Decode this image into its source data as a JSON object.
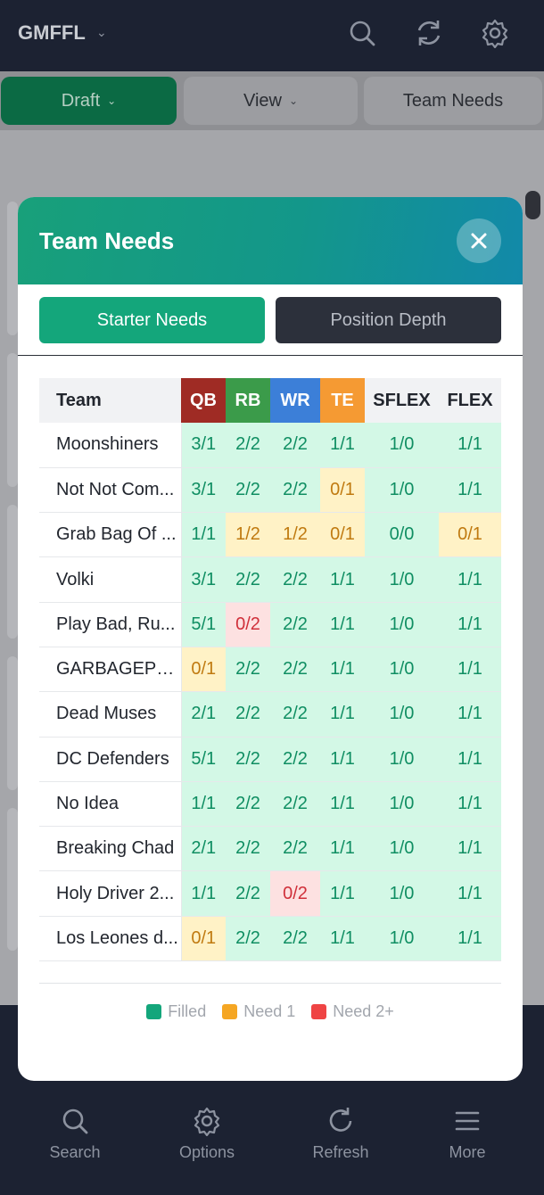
{
  "app": {
    "title": "GMFFL"
  },
  "toolbar": {
    "draft_label": "Draft",
    "view_label": "View",
    "team_needs_label": "Team Needs"
  },
  "modal": {
    "title": "Team Needs",
    "segments": {
      "starter": "Starter Needs",
      "depth": "Position Depth"
    },
    "columns": [
      "Team",
      "QB",
      "RB",
      "WR",
      "TE",
      "SFLEX",
      "FLEX"
    ],
    "rows": [
      {
        "team": "Moonshiners",
        "values": [
          "3/1",
          "2/2",
          "2/2",
          "1/1",
          "1/0",
          "1/1"
        ],
        "status": [
          "filled",
          "filled",
          "filled",
          "filled",
          "filled",
          "filled"
        ]
      },
      {
        "team": "Not Not Com...",
        "values": [
          "3/1",
          "2/2",
          "2/2",
          "0/1",
          "1/0",
          "1/1"
        ],
        "status": [
          "filled",
          "filled",
          "filled",
          "need1",
          "filled",
          "filled"
        ]
      },
      {
        "team": "Grab Bag Of ...",
        "values": [
          "1/1",
          "1/2",
          "1/2",
          "0/1",
          "0/0",
          "0/1"
        ],
        "status": [
          "filled",
          "need1",
          "need1",
          "need1",
          "filled",
          "need1"
        ]
      },
      {
        "team": "Volki",
        "values": [
          "3/1",
          "2/2",
          "2/2",
          "1/1",
          "1/0",
          "1/1"
        ],
        "status": [
          "filled",
          "filled",
          "filled",
          "filled",
          "filled",
          "filled"
        ]
      },
      {
        "team": "Play Bad, Ru...",
        "values": [
          "5/1",
          "0/2",
          "2/2",
          "1/1",
          "1/0",
          "1/1"
        ],
        "status": [
          "filled",
          "need2",
          "filled",
          "filled",
          "filled",
          "filled"
        ]
      },
      {
        "team": "GARBAGEPL...",
        "values": [
          "0/1",
          "2/2",
          "2/2",
          "1/1",
          "1/0",
          "1/1"
        ],
        "status": [
          "need1",
          "filled",
          "filled",
          "filled",
          "filled",
          "filled"
        ]
      },
      {
        "team": "Dead Muses",
        "values": [
          "2/1",
          "2/2",
          "2/2",
          "1/1",
          "1/0",
          "1/1"
        ],
        "status": [
          "filled",
          "filled",
          "filled",
          "filled",
          "filled",
          "filled"
        ]
      },
      {
        "team": "DC Defenders",
        "values": [
          "5/1",
          "2/2",
          "2/2",
          "1/1",
          "1/0",
          "1/1"
        ],
        "status": [
          "filled",
          "filled",
          "filled",
          "filled",
          "filled",
          "filled"
        ]
      },
      {
        "team": "No Idea",
        "values": [
          "1/1",
          "2/2",
          "2/2",
          "1/1",
          "1/0",
          "1/1"
        ],
        "status": [
          "filled",
          "filled",
          "filled",
          "filled",
          "filled",
          "filled"
        ]
      },
      {
        "team": "Breaking Chad",
        "values": [
          "2/1",
          "2/2",
          "2/2",
          "1/1",
          "1/0",
          "1/1"
        ],
        "status": [
          "filled",
          "filled",
          "filled",
          "filled",
          "filled",
          "filled"
        ]
      },
      {
        "team": "Holy Driver 2...",
        "values": [
          "1/1",
          "2/2",
          "0/2",
          "1/1",
          "1/0",
          "1/1"
        ],
        "status": [
          "filled",
          "filled",
          "need2",
          "filled",
          "filled",
          "filled"
        ]
      },
      {
        "team": "Los Leones d...",
        "values": [
          "0/1",
          "2/2",
          "2/2",
          "1/1",
          "1/0",
          "1/1"
        ],
        "status": [
          "need1",
          "filled",
          "filled",
          "filled",
          "filled",
          "filled"
        ]
      }
    ],
    "legend": [
      {
        "label": "Filled",
        "color": "#14a67b"
      },
      {
        "label": "Need 1",
        "color": "#f5a623"
      },
      {
        "label": "Need 2+",
        "color": "#ef4444"
      }
    ]
  },
  "bottom_nav": [
    {
      "label": "Search",
      "icon": "search-icon"
    },
    {
      "label": "Options",
      "icon": "gear-icon"
    },
    {
      "label": "Refresh",
      "icon": "refresh-icon"
    },
    {
      "label": "More",
      "icon": "menu-icon"
    }
  ],
  "colors": {
    "header_bg": "#1c2232",
    "accent": "#14a67b",
    "qb": "#9f2b24",
    "rb": "#3b9b4a",
    "wr": "#3c7fd8",
    "te": "#f59a33"
  }
}
